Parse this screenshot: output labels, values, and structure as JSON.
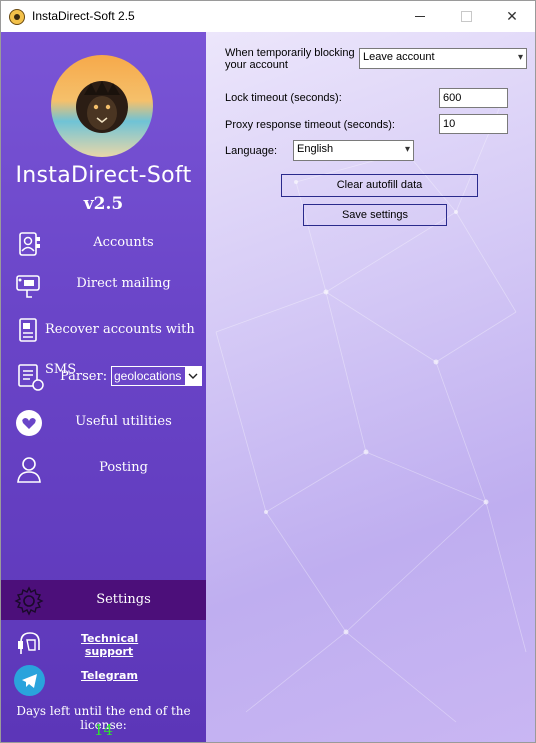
{
  "window": {
    "title": "InstaDirect-Soft 2.5"
  },
  "sidebar": {
    "brand_name": "InstaDirect-Soft",
    "brand_version": "v2.5",
    "items": [
      {
        "label": "Accounts",
        "icon": "accounts-icon"
      },
      {
        "label": "Direct mailing",
        "icon": "direct-mailing-icon"
      },
      {
        "label": "Recover accounts with SMS",
        "icon": "sms-recover-icon"
      },
      {
        "label": "Useful utilities",
        "icon": "heart-icon"
      },
      {
        "label": "Posting",
        "icon": "user-icon"
      }
    ],
    "parser": {
      "label": "Parser:",
      "value": "geolocations"
    },
    "settings_label": "Settings",
    "support_label": "Technical support",
    "telegram_label": "Telegram",
    "license_label": "Days left until the end of the license:",
    "license_days": "14"
  },
  "settings": {
    "blocking_label": "When temporarily blocking your account",
    "blocking_value": "Leave account",
    "lock_timeout_label": "Lock timeout (seconds):",
    "lock_timeout_value": "600",
    "proxy_timeout_label": "Proxy response timeout (seconds):",
    "proxy_timeout_value": "10",
    "language_label": "Language:",
    "language_value": "English",
    "clear_button": "Clear autofill data",
    "save_button": "Save settings"
  },
  "colors": {
    "sidebar": "#6a45c8",
    "selected": "#4c0f7a",
    "license_days": "#2ee62e"
  }
}
